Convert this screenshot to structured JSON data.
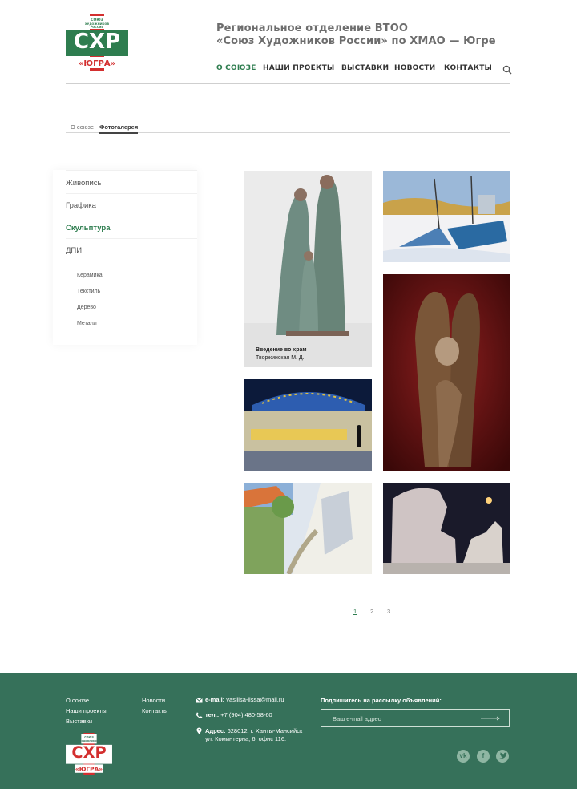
{
  "header": {
    "logo_top_text": "СОЮЗ ХУДОЖНИКОВ РОССИИ",
    "logo_letters": "СХР",
    "logo_bottom": "«ЮГРА»",
    "title_line1": "Региональное отделение ВТОО",
    "title_line2": "«Союз Художников России» по ХМАО — Югре",
    "nav": [
      {
        "label": "О СОЮЗЕ",
        "active": true
      },
      {
        "label": "НАШИ ПРОЕКТЫ",
        "active": false
      },
      {
        "label": "ВЫСТАВКИ",
        "active": false
      },
      {
        "label": "НОВОСТИ",
        "active": false
      },
      {
        "label": "КОНТАКТЫ",
        "active": false
      }
    ],
    "search_icon": "search-icon"
  },
  "breadcrumb": {
    "items": [
      {
        "label": "О союзе",
        "active": false
      },
      {
        "label": "Фотогалерея",
        "active": true
      }
    ]
  },
  "sidebar": {
    "items": [
      {
        "label": "Живопись",
        "active": false
      },
      {
        "label": "Графика",
        "active": false
      },
      {
        "label": "Скульптура",
        "active": true
      },
      {
        "label": "ДПИ",
        "active": false
      }
    ],
    "subitems": [
      "Керамика",
      "Текстиль",
      "Дерево",
      "Металл"
    ]
  },
  "gallery": {
    "featured_caption": {
      "title": "Введение во храм",
      "author": "Творжинская М. Д."
    }
  },
  "pagination": {
    "pages": [
      "1",
      "2",
      "3",
      "..."
    ],
    "current": "1"
  },
  "footer": {
    "links_col1": [
      "О союзе",
      "Наши проекты",
      "Выставки"
    ],
    "links_col2": [
      "Новости",
      "Контакты"
    ],
    "email_label": "e-mail:",
    "email": "vasilisa-lissa@mail.ru",
    "phone_label": "тел.:",
    "phone": "+7 (904) 480-58-60",
    "address_label": "Адрес:",
    "address_line1": "628012, г. Ханты-Мансийск",
    "address_line2": "ул. Коминтерна, 6, офис 116.",
    "subscribe_title": "Подпишитесь на рассылку объявлений:",
    "subscribe_placeholder": "Ваш e-mail адрес",
    "social": [
      "vk",
      "f",
      "twitter"
    ]
  },
  "colors": {
    "accent_green": "#2e7d4f",
    "logo_red": "#d32f2f",
    "footer_bg": "#36715a"
  }
}
